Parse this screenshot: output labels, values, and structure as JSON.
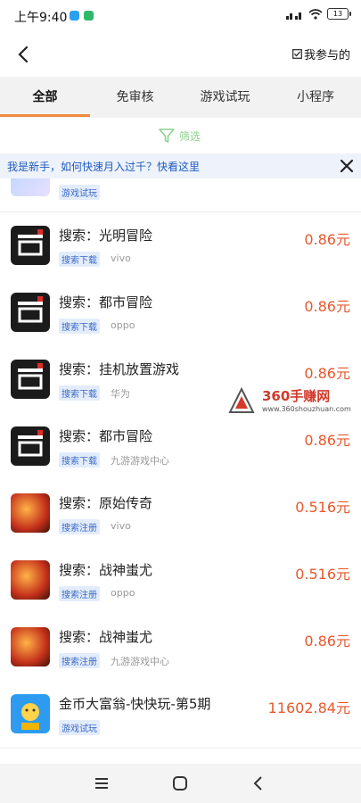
{
  "status_bar": {
    "time": "上午9:40",
    "battery": "13"
  },
  "nav": {
    "my_joined": "我参与的"
  },
  "tabs": [
    {
      "label": "全部",
      "active": true
    },
    {
      "label": "免审核",
      "active": false
    },
    {
      "label": "游戏试玩",
      "active": false
    },
    {
      "label": "小程序",
      "active": false
    }
  ],
  "filter": {
    "label": "筛选"
  },
  "notice": {
    "text": "我是新手，如何快速月入过千？快看这里"
  },
  "list": [
    {
      "title": "",
      "tag": "游戏试玩",
      "sub": "",
      "price": "",
      "icon": "game-icon-anime"
    },
    {
      "title": "搜索：光明冒险",
      "tag": "搜索下载",
      "sub": "vivo",
      "price": "0.86元",
      "icon": "game-icon-dark"
    },
    {
      "title": "搜索：都市冒险",
      "tag": "搜索下载",
      "sub": "oppo",
      "price": "0.86元",
      "icon": "game-icon-dark"
    },
    {
      "title": "搜索：挂机放置游戏",
      "tag": "搜索下载",
      "sub": "华为",
      "price": "0.86元",
      "icon": "game-icon-dark"
    },
    {
      "title": "搜索：都市冒险",
      "tag": "搜索下载",
      "sub": "九游游戏中心",
      "price": "0.86元",
      "icon": "game-icon-dark"
    },
    {
      "title": "搜索：原始传奇",
      "tag": "搜索注册",
      "sub": "vivo",
      "price": "0.516元",
      "icon": "game-icon-fire"
    },
    {
      "title": "搜索：战神蚩尤",
      "tag": "搜索注册",
      "sub": "oppo",
      "price": "0.516元",
      "icon": "game-icon-fire"
    },
    {
      "title": "搜索：战神蚩尤",
      "tag": "搜索注册",
      "sub": "九游游戏中心",
      "price": "0.86元",
      "icon": "game-icon-fire"
    },
    {
      "title": "金币大富翁-快快玩-第5期",
      "tag": "游戏试玩",
      "sub": "",
      "price": "11602.84元",
      "icon": "game-icon-coin"
    }
  ],
  "watermark": {
    "title": "360手赚网",
    "url": "www.360shouzhuan.com"
  },
  "colors": {
    "accent": "#f08a3c",
    "price": "#e8582c",
    "link": "#1f5bbf",
    "filter": "#8dd18d"
  }
}
